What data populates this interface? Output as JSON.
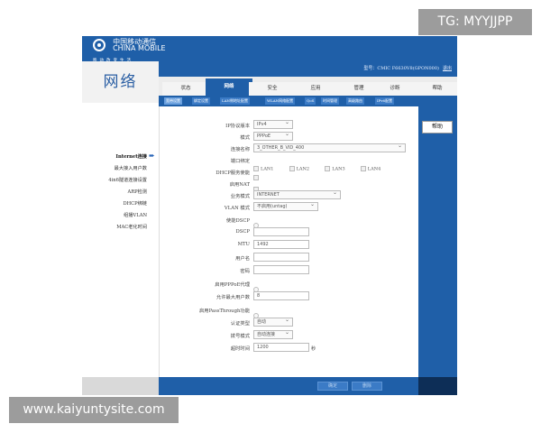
{
  "watermark": {
    "top": "TG: MYYJJPP",
    "bottom": "www.kaiyuntysite.com"
  },
  "brand": {
    "cn": "中国移动通信",
    "en": "CHINA MOBILE",
    "slogan": "移动改变生活"
  },
  "model_bar": {
    "text": "型号：",
    "model": "CMIC F6630V8(GPON000)",
    "logout": "退出"
  },
  "section_title": "网络",
  "tabs": [
    "状态",
    "网络",
    "安全",
    "应用",
    "管理",
    "诊断",
    "帮助"
  ],
  "subtabs": [
    "宽带设置",
    "绑定设置",
    "LAN侧地址配置",
    "WLAN网络配置",
    "QoS",
    "时间管理",
    "高级路由",
    "IPv6配置"
  ],
  "left_menu": [
    "Internet连接",
    "最大接入用户数",
    "4in6隧道连接设置",
    "ARP检测",
    "DHCP绑链",
    "组播VLAN",
    "MAC老化时间"
  ],
  "help_label": "帮助",
  "form": {
    "ip_protocol": {
      "label": "IP协议版本",
      "value": "IPv4"
    },
    "mode": {
      "label": "模式",
      "value": "PPPoE"
    },
    "conn_name": {
      "label": "连接名称",
      "value": "3_OTHER_B_VID_400"
    },
    "port_bind": {
      "label": "端口绑定",
      "lans": [
        "LAN1",
        "LAN2",
        "LAN3",
        "LAN4"
      ]
    },
    "dhcp_enable": {
      "label": "DHCP服务使能"
    },
    "nat": {
      "label": "启用NAT"
    },
    "service_mode": {
      "label": "业务模式",
      "value": "INTERNET"
    },
    "vlan_mode": {
      "label": "VLAN 模式",
      "value": "不启用(untag)"
    },
    "enable_dscp": {
      "label": "使能DSCP"
    },
    "dscp": {
      "label": "DSCP",
      "value": ""
    },
    "mtu": {
      "label": "MTU",
      "value": "1492"
    },
    "username": {
      "label": "用户名",
      "value": ""
    },
    "password": {
      "label": "密码",
      "value": ""
    },
    "pppoe_proxy": {
      "label": "启用PPPoE代理"
    },
    "max_users": {
      "label": "允许最大用户数",
      "value": "8"
    },
    "passthrough": {
      "label": "启用PassThrough功能"
    },
    "auth_type": {
      "label": "认证类型",
      "value": "自动"
    },
    "dial_mode": {
      "label": "拨号模式",
      "value": "自动连接"
    },
    "timeout": {
      "label": "超时时间",
      "value": "1200",
      "unit": "秒"
    }
  },
  "bottom_buttons": [
    "确定",
    "删除"
  ]
}
